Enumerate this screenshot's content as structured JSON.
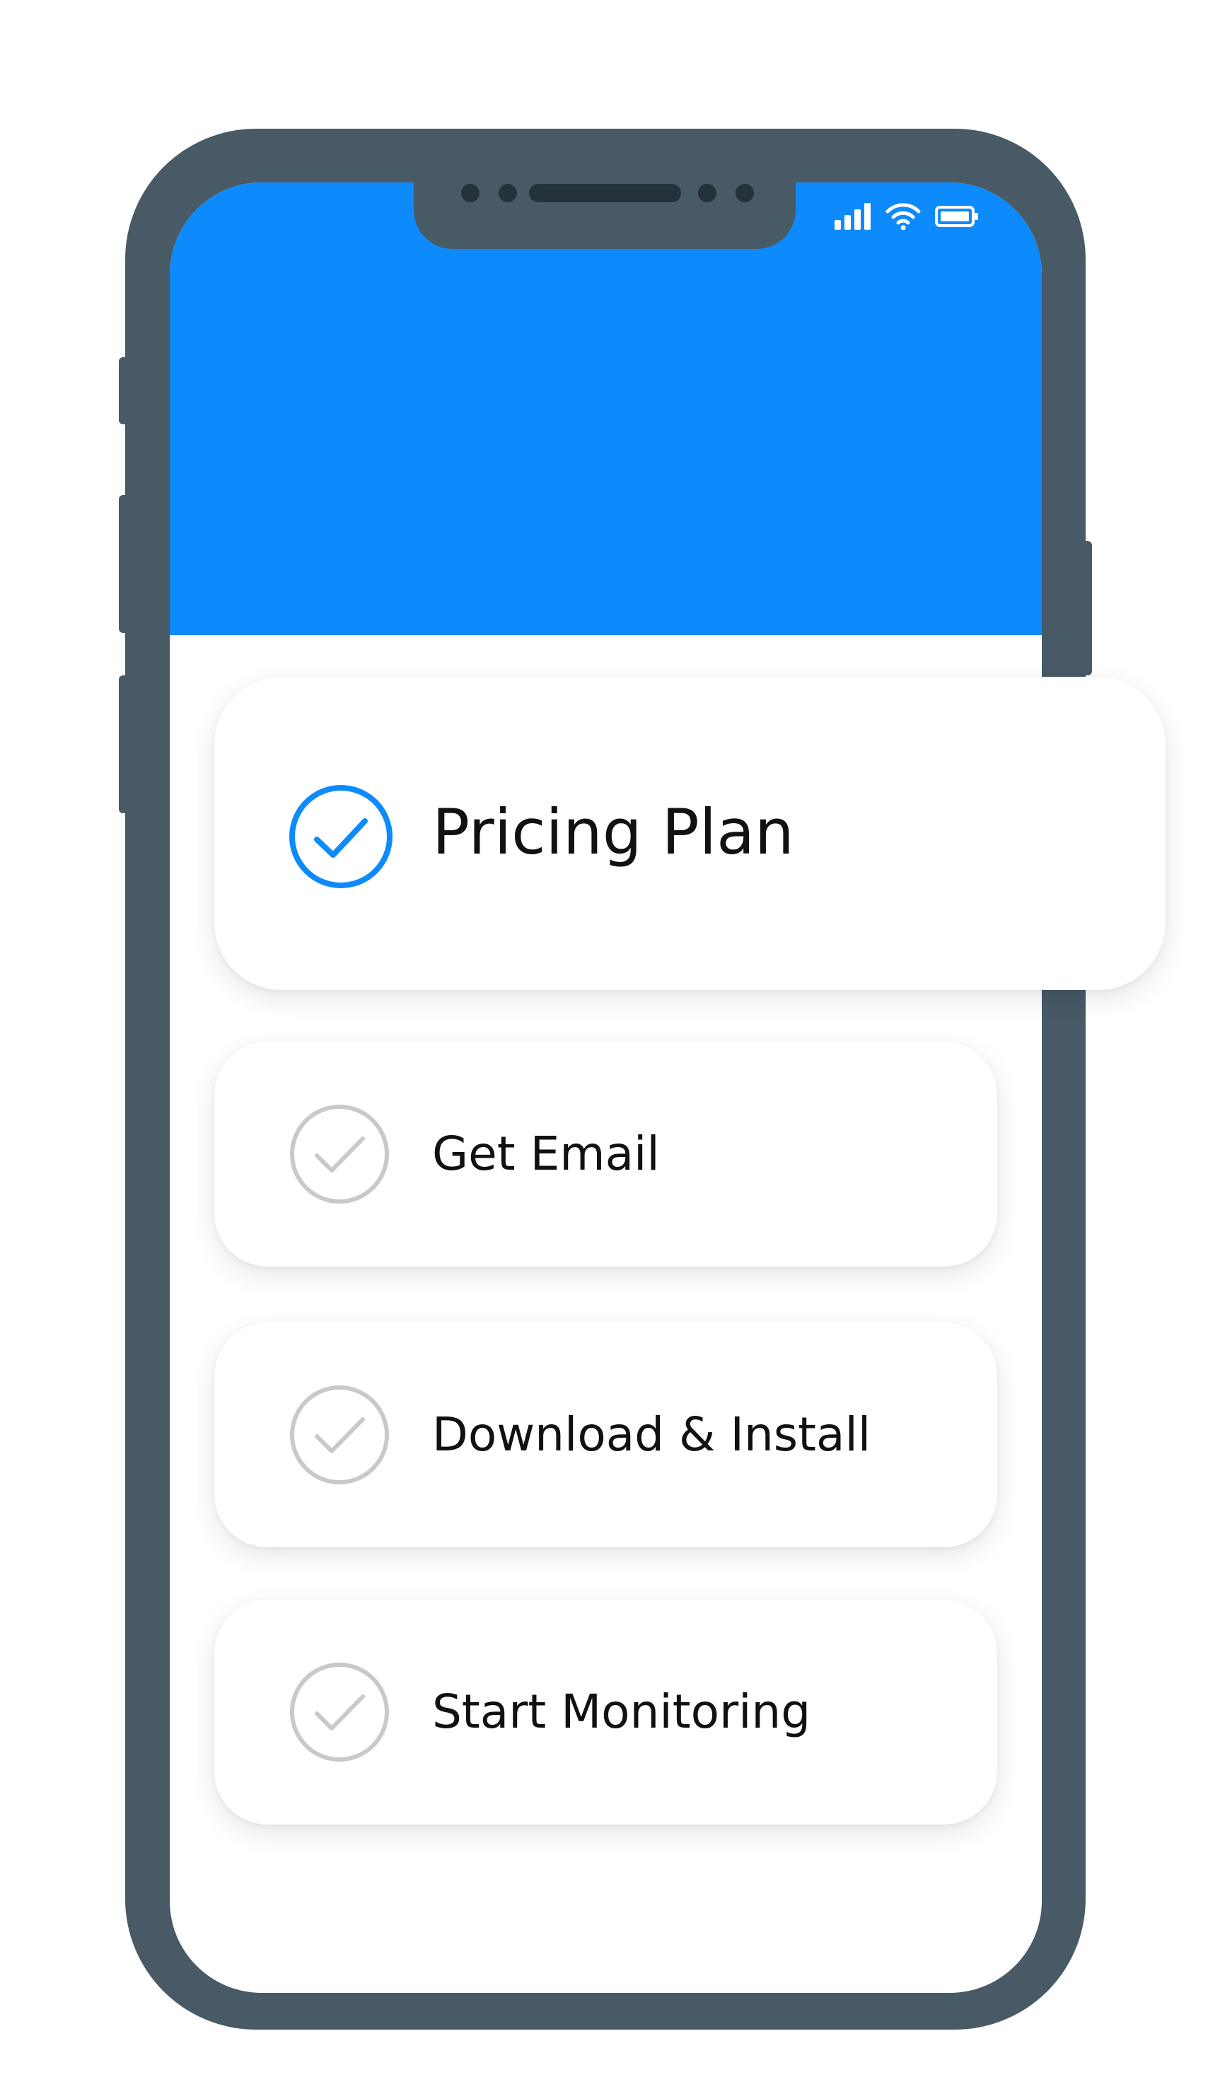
{
  "colors": {
    "accent": "#0d8afb",
    "phone_frame": "#475a66",
    "inactive_check": "#c9c9c9"
  },
  "steps": [
    {
      "label": "Pricing Plan",
      "state": "active",
      "icon": "check-circle-icon"
    },
    {
      "label": "Get Email",
      "state": "pending",
      "icon": "check-circle-icon"
    },
    {
      "label": "Download & Install",
      "state": "pending",
      "icon": "check-circle-icon"
    },
    {
      "label": "Start Monitoring",
      "state": "pending",
      "icon": "check-circle-icon"
    }
  ],
  "status_bar": {
    "icons": [
      "signal-icon",
      "wifi-icon",
      "battery-icon"
    ]
  }
}
